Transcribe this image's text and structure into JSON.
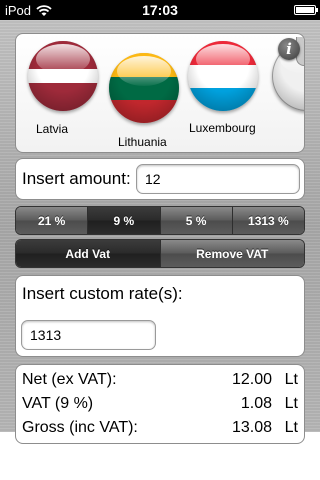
{
  "status_bar": {
    "carrier": "iPod",
    "time": "17:03"
  },
  "countries": [
    {
      "name": "Latvia",
      "stripes": [
        "#9e2a3a",
        "#ffffff",
        "#9e2a3a"
      ],
      "ratios": [
        2,
        1,
        2
      ]
    },
    {
      "name": "Lithuania",
      "stripes": [
        "#fdb913",
        "#006a44",
        "#c1272d"
      ],
      "ratios": [
        1,
        1,
        1
      ]
    },
    {
      "name": "Luxembourg",
      "stripes": [
        "#ed2939",
        "#ffffff",
        "#00a1de"
      ],
      "ratios": [
        1,
        1,
        1
      ]
    }
  ],
  "info_icon": "info-icon",
  "amount": {
    "label": "Insert amount:",
    "value": "12"
  },
  "rates": [
    "21 %",
    "9 %",
    "5 %",
    "1313 %"
  ],
  "selected_rate_index": 1,
  "actions": {
    "add_label": "Add Vat",
    "remove_label": "Remove VAT"
  },
  "custom": {
    "label": "Insert custom rate(s):",
    "value": "1313"
  },
  "results": [
    {
      "label": "Net (ex VAT):",
      "value": "12.00",
      "unit": "Lt"
    },
    {
      "label": "VAT (9 %)",
      "value": "1.08",
      "unit": "Lt"
    },
    {
      "label": "Gross (inc VAT):",
      "value": "13.08",
      "unit": "Lt"
    }
  ]
}
